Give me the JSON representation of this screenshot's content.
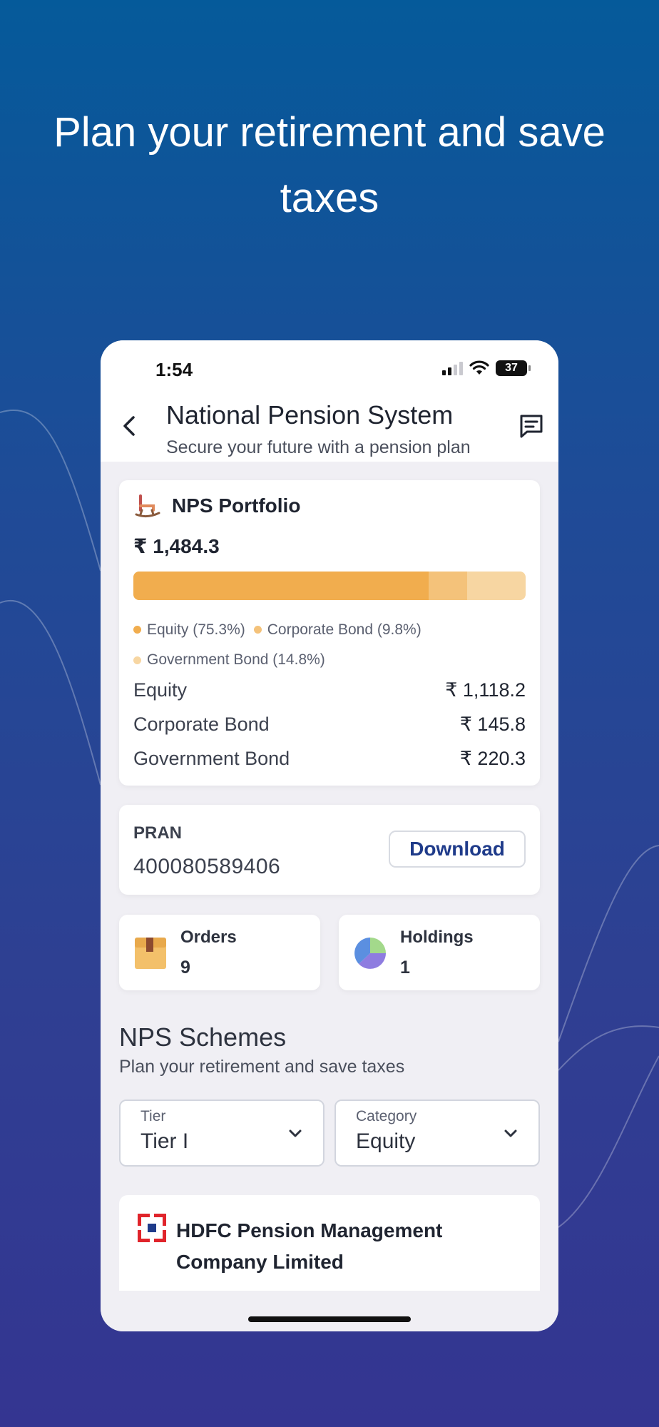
{
  "headline": "Plan your retirement and save taxes",
  "status_bar": {
    "time": "1:54",
    "battery": "37"
  },
  "nav": {
    "title": "National Pension System",
    "subtitle": "Secure your future with a pension plan"
  },
  "portfolio": {
    "title": "NPS Portfolio",
    "total": "₹ 1,484.3",
    "allocation": [
      {
        "name": "Equity",
        "legend": "Equity (75.3%)",
        "percent": 75.3,
        "color": "#f1ad4e",
        "value": "₹ 1,118.2"
      },
      {
        "name": "Corporate Bond",
        "legend": "Corporate Bond (9.8%)",
        "percent": 9.8,
        "color": "#f4c27a",
        "value": "₹ 145.8"
      },
      {
        "name": "Government Bond",
        "legend": "Government Bond (14.8%)",
        "percent": 14.8,
        "color": "#f7d6a2",
        "value": "₹ 220.3"
      }
    ]
  },
  "pran": {
    "label": "PRAN",
    "value": "400080589406",
    "download_label": "Download"
  },
  "orders": {
    "label": "Orders",
    "count": "9"
  },
  "holdings": {
    "label": "Holdings",
    "count": "1"
  },
  "schemes": {
    "title": "NPS Schemes",
    "subtitle": "Plan your retirement and save taxes",
    "tier": {
      "label": "Tier",
      "value": "Tier I"
    },
    "category": {
      "label": "Category",
      "value": "Equity"
    },
    "first_fund": "HDFC Pension Management Company Limited"
  },
  "colors": {
    "accent": "#1f3b8a",
    "background_top": "#055a9a",
    "background_bottom": "#343591",
    "hdfc_red": "#e0242b",
    "hdfc_blue": "#1f3b8a"
  },
  "icons": [
    "back-arrow-icon",
    "chat-icon",
    "rocking-chair-icon",
    "box-icon",
    "pie-chart-icon",
    "chevron-down-icon",
    "hdfc-logo-icon",
    "signal-icon",
    "wifi-icon",
    "battery-icon"
  ]
}
